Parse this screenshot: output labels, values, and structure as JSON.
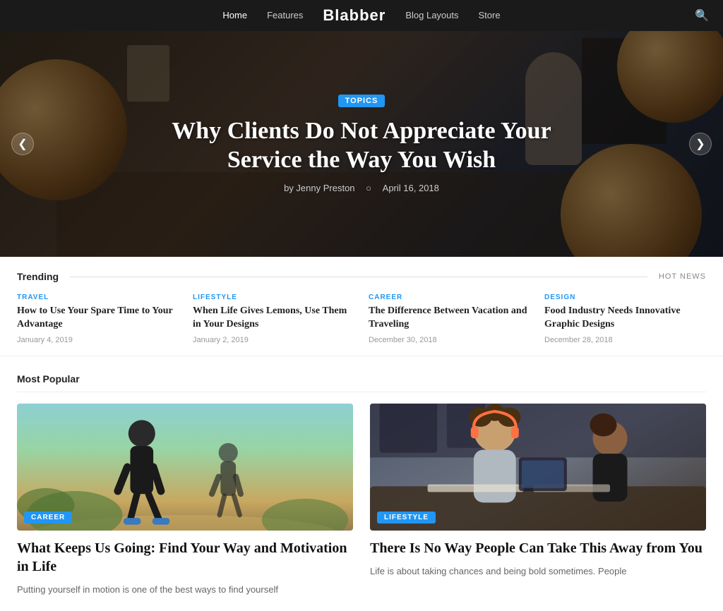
{
  "nav": {
    "logo": "Blabber",
    "links": [
      {
        "label": "Home",
        "active": true
      },
      {
        "label": "Features",
        "active": false
      },
      {
        "label": "Blog Layouts",
        "active": false
      },
      {
        "label": "Store",
        "active": false
      }
    ],
    "search_icon": "🔍"
  },
  "hero": {
    "badge": "TOPICS",
    "title": "Why Clients Do Not Appreciate Your Service the Way You Wish",
    "author": "by Jenny Preston",
    "date": "April 16, 2018",
    "prev_arrow": "❮",
    "next_arrow": "❯"
  },
  "trending": {
    "section_title": "Trending",
    "hot_news_label": "HOT NEWS",
    "items": [
      {
        "category": "TRAVEL",
        "category_class": "cat-travel",
        "title": "How to Use Your Spare Time to Your Advantage",
        "date": "January 4, 2019"
      },
      {
        "category": "LIFESTYLE",
        "category_class": "cat-lifestyle",
        "title": "When Life Gives Lemons, Use Them in Your Designs",
        "date": "January 2, 2019"
      },
      {
        "category": "CAREER",
        "category_class": "cat-career",
        "title": "The Difference Between Vacation and Traveling",
        "date": "December 30, 2018"
      },
      {
        "category": "DESIGN",
        "category_class": "cat-design",
        "title": "Food Industry Needs Innovative Graphic Designs",
        "date": "December 28, 2018"
      }
    ]
  },
  "popular": {
    "section_title": "Most Popular",
    "cards": [
      {
        "badge": "CAREER",
        "title": "What Keeps Us Going: Find Your Way and Motivation in Life",
        "excerpt": "Putting yourself in motion is one of the best ways to find yourself",
        "image_class": "img-running"
      },
      {
        "badge": "LIFESTYLE",
        "title": "There Is No Way People Can Take This Away from You",
        "excerpt": "Life is about taking chances and being bold sometimes. People",
        "image_class": "img-workshop"
      }
    ]
  }
}
